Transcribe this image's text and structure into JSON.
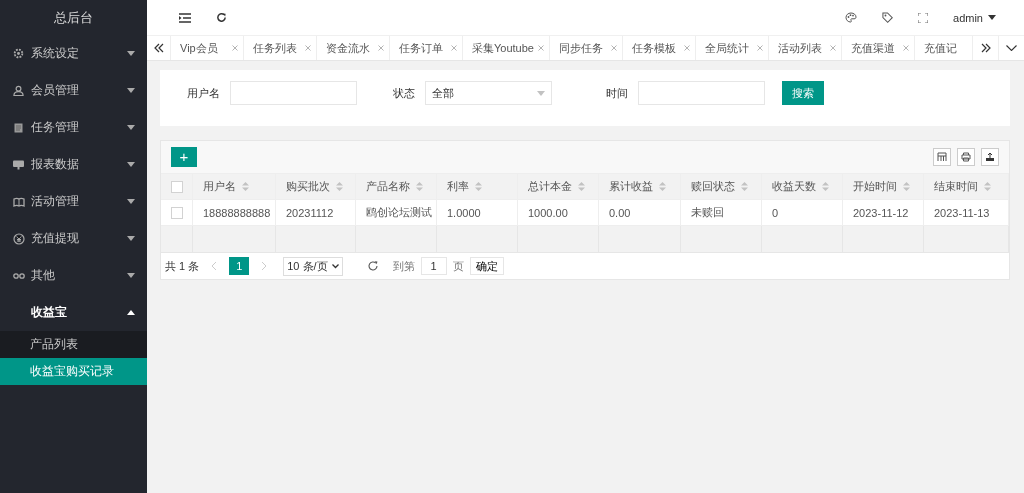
{
  "sidebar": {
    "title": "总后台",
    "items": [
      {
        "label": "系统设定",
        "kind": "gear",
        "expanded": false
      },
      {
        "label": "会员管理",
        "kind": "user",
        "expanded": false
      },
      {
        "label": "任务管理",
        "kind": "doc",
        "expanded": false
      },
      {
        "label": "报表数据",
        "kind": "monitor",
        "expanded": false
      },
      {
        "label": "活动管理",
        "kind": "book",
        "expanded": false
      },
      {
        "label": "充值提现",
        "kind": "coin",
        "expanded": false
      },
      {
        "label": "其他",
        "kind": "link",
        "expanded": false
      },
      {
        "label": "收益宝",
        "kind": "plain",
        "expanded": true,
        "children": [
          {
            "label": "产品列表",
            "selected": false
          },
          {
            "label": "收益宝购买记录",
            "selected": true
          }
        ]
      }
    ]
  },
  "header": {
    "user": "admin"
  },
  "tabs": [
    {
      "label": "Vip会员",
      "closable": true,
      "selected": false
    },
    {
      "label": "任务列表",
      "closable": true,
      "selected": false
    },
    {
      "label": "资金流水",
      "closable": true,
      "selected": false
    },
    {
      "label": "任务订单",
      "closable": true,
      "selected": false
    },
    {
      "label": "采集Youtube",
      "closable": true,
      "selected": false
    },
    {
      "label": "同步任务",
      "closable": true,
      "selected": false
    },
    {
      "label": "任务模板",
      "closable": true,
      "selected": false
    },
    {
      "label": "全局统计",
      "closable": true,
      "selected": false
    },
    {
      "label": "活动列表",
      "closable": true,
      "selected": false
    },
    {
      "label": "充值渠道",
      "closable": true,
      "selected": false
    },
    {
      "label": "充值记",
      "closable": false,
      "selected": false
    }
  ],
  "filters": [
    {
      "label": "用户名",
      "kind": "input"
    },
    {
      "label": "状态",
      "kind": "select",
      "value": "全部"
    },
    {
      "label": "时间",
      "kind": "input"
    }
  ],
  "search_button": "搜索",
  "table": {
    "add_button": "+",
    "header_checked": false,
    "columns": [
      "用户名",
      "购买批次",
      "产品名称",
      "利率",
      "总计本金",
      "累计收益",
      "赎回状态",
      "收益天数",
      "开始时间",
      "结束时间"
    ],
    "rows": [
      {
        "checked": false,
        "cells": [
          "18888888888",
          "20231112",
          "鸥创论坛测试",
          "1.0000",
          "1000.00",
          "0.00",
          "未赎回",
          "0",
          "2023-11-12",
          "2023-11-13"
        ]
      }
    ]
  },
  "pagination": {
    "total": "共 1 条",
    "pages": [
      {
        "label": "1",
        "selected": true
      }
    ],
    "page_size": "10 条/页",
    "goto_label": "到第",
    "goto_value": "1",
    "page_unit": "页",
    "confirm": "确定"
  }
}
